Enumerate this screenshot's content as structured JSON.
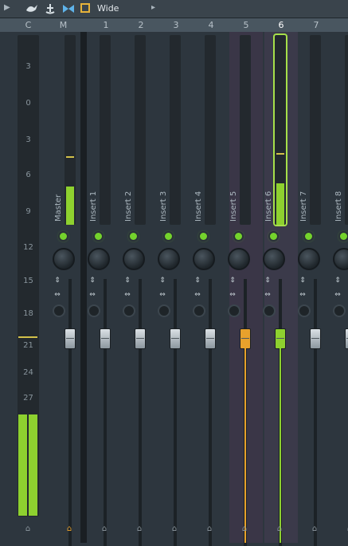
{
  "toolbar": {
    "icons": [
      "play-arrow-icon",
      "bird-icon",
      "anchor-icon",
      "bowtie-icon",
      "color-swatch-icon",
      "menu-arrow-icon"
    ],
    "mode_label": "Wide",
    "colors": {
      "swatch": "#e7b33a"
    }
  },
  "header": {
    "channels": [
      "C",
      "M",
      "1",
      "2",
      "3",
      "4",
      "5",
      "6",
      "7"
    ],
    "active_channel": "6"
  },
  "master_scale": [
    "3",
    "0",
    "3",
    "6",
    "9",
    "12",
    "15",
    "18",
    "21",
    "24",
    "27"
  ],
  "tracks": [
    {
      "id": "master",
      "name": "Master",
      "meter_level": 0.2,
      "fader_color": "#c8ced2"
    },
    {
      "id": "insert-1",
      "name": "Insert 1",
      "meter_level": 0.0,
      "fader_color": "#c8ced2"
    },
    {
      "id": "insert-2",
      "name": "Insert 2",
      "meter_level": 0.0,
      "fader_color": "#c8ced2"
    },
    {
      "id": "insert-3",
      "name": "Insert 3",
      "meter_level": 0.0,
      "fader_color": "#c8ced2"
    },
    {
      "id": "insert-4",
      "name": "Insert 4",
      "meter_level": 0.0,
      "fader_color": "#c8ced2"
    },
    {
      "id": "insert-5",
      "name": "Insert 5",
      "meter_level": 0.0,
      "fader_color": "#e8a12c"
    },
    {
      "id": "insert-6",
      "name": "Insert 6",
      "meter_level": 0.22,
      "fader_color": "#8ed12f"
    },
    {
      "id": "insert-7",
      "name": "Insert 7",
      "meter_level": 0.0,
      "fader_color": "#c8ced2"
    },
    {
      "id": "insert-8",
      "name": "Insert 8",
      "meter_level": 0.0,
      "fader_color": "#c8ced2"
    }
  ],
  "colors": {
    "accent_green": "#8ed12f",
    "accent_orange": "#e8a12c",
    "selected_outline": "#a6e04a"
  }
}
